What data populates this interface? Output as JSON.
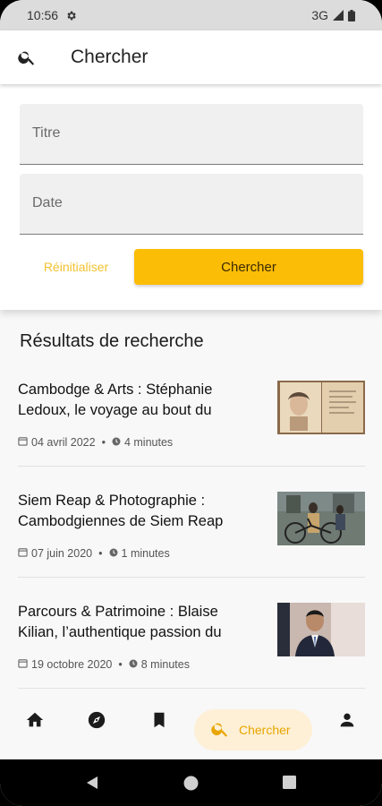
{
  "status_bar": {
    "time": "10:56",
    "network": "3G"
  },
  "app_bar": {
    "title": "Chercher"
  },
  "search_form": {
    "title_placeholder": "Titre",
    "date_placeholder": "Date",
    "reset_label": "Réinitialiser",
    "search_label": "Chercher"
  },
  "results": {
    "heading": "Résultats de recherche",
    "items": [
      {
        "title": "Cambodge & Arts : Stéphanie Ledoux, le voyage au bout du",
        "date": "04 avril 2022",
        "duration": "4 minutes"
      },
      {
        "title": "Siem Reap & Photographie : Cambodgiennes de Siem Reap",
        "date": "07 juin 2020",
        "duration": "1 minutes"
      },
      {
        "title": "Parcours & Patrimoine : Blaise Kilian, l’authentique passion du",
        "date": "19 octobre 2020",
        "duration": "8 minutes"
      }
    ]
  },
  "bottom_nav": {
    "items": [
      "home-icon",
      "explore-icon",
      "bookmark-icon",
      "search-icon",
      "account-icon"
    ],
    "active_label": "Chercher"
  },
  "colors": {
    "accent": "#fcbd06",
    "accent_soft": "#fdf0d6",
    "reset_text": "#f2c231"
  }
}
